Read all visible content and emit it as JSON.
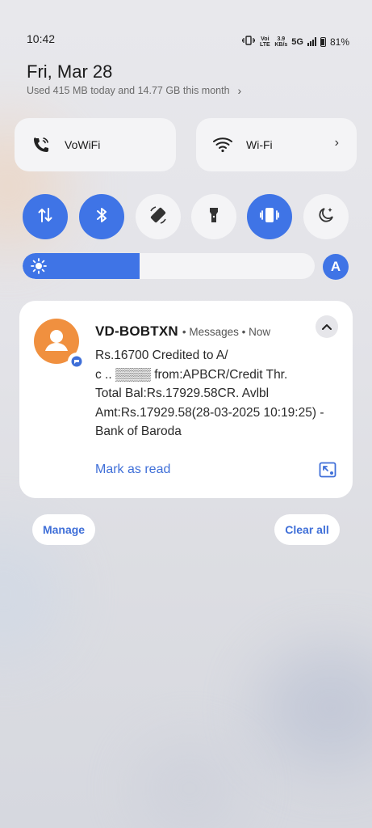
{
  "status_bar": {
    "time": "10:42",
    "volte_label": "Voi LTE",
    "speed_value": "3.9",
    "speed_unit": "KB/s",
    "network": "5G",
    "battery": "81%"
  },
  "header": {
    "date": "Fri, Mar 28",
    "data_usage": "Used 415 MB today and 14.77 GB this month"
  },
  "tiles": [
    {
      "label": "VoWiFi",
      "icon": "wifi-call-icon"
    },
    {
      "label": "Wi-Fi",
      "icon": "wifi-icon"
    }
  ],
  "quick_settings": [
    {
      "icon": "mobile-data-icon",
      "state": "on"
    },
    {
      "icon": "bluetooth-icon",
      "state": "on"
    },
    {
      "icon": "auto-rotate-icon",
      "state": "off"
    },
    {
      "icon": "flashlight-icon",
      "state": "off"
    },
    {
      "icon": "vibrate-icon",
      "state": "on"
    },
    {
      "icon": "night-mode-icon",
      "state": "off"
    }
  ],
  "brightness": {
    "level": 0.4,
    "auto_label": "A"
  },
  "notification": {
    "sender": "VD-BOBTXN",
    "app": "• Messages • Now",
    "body": "Rs.16700 Credited to A/\nc .. ▒▒▒▒ from:APBCR/Credit Thr.\nTotal Bal:Rs.17929.58CR. Avlbl\nAmt:Rs.17929.58(28-03-2025 10:19:25) -\nBank of Baroda",
    "action": "Mark as read"
  },
  "footer": {
    "manage": "Manage",
    "clear_all": "Clear all"
  },
  "colors": {
    "accent": "#3f74e6",
    "link": "#3f6fd8",
    "avatar": "#f0903f",
    "tile_bg": "#f4f4f6"
  }
}
